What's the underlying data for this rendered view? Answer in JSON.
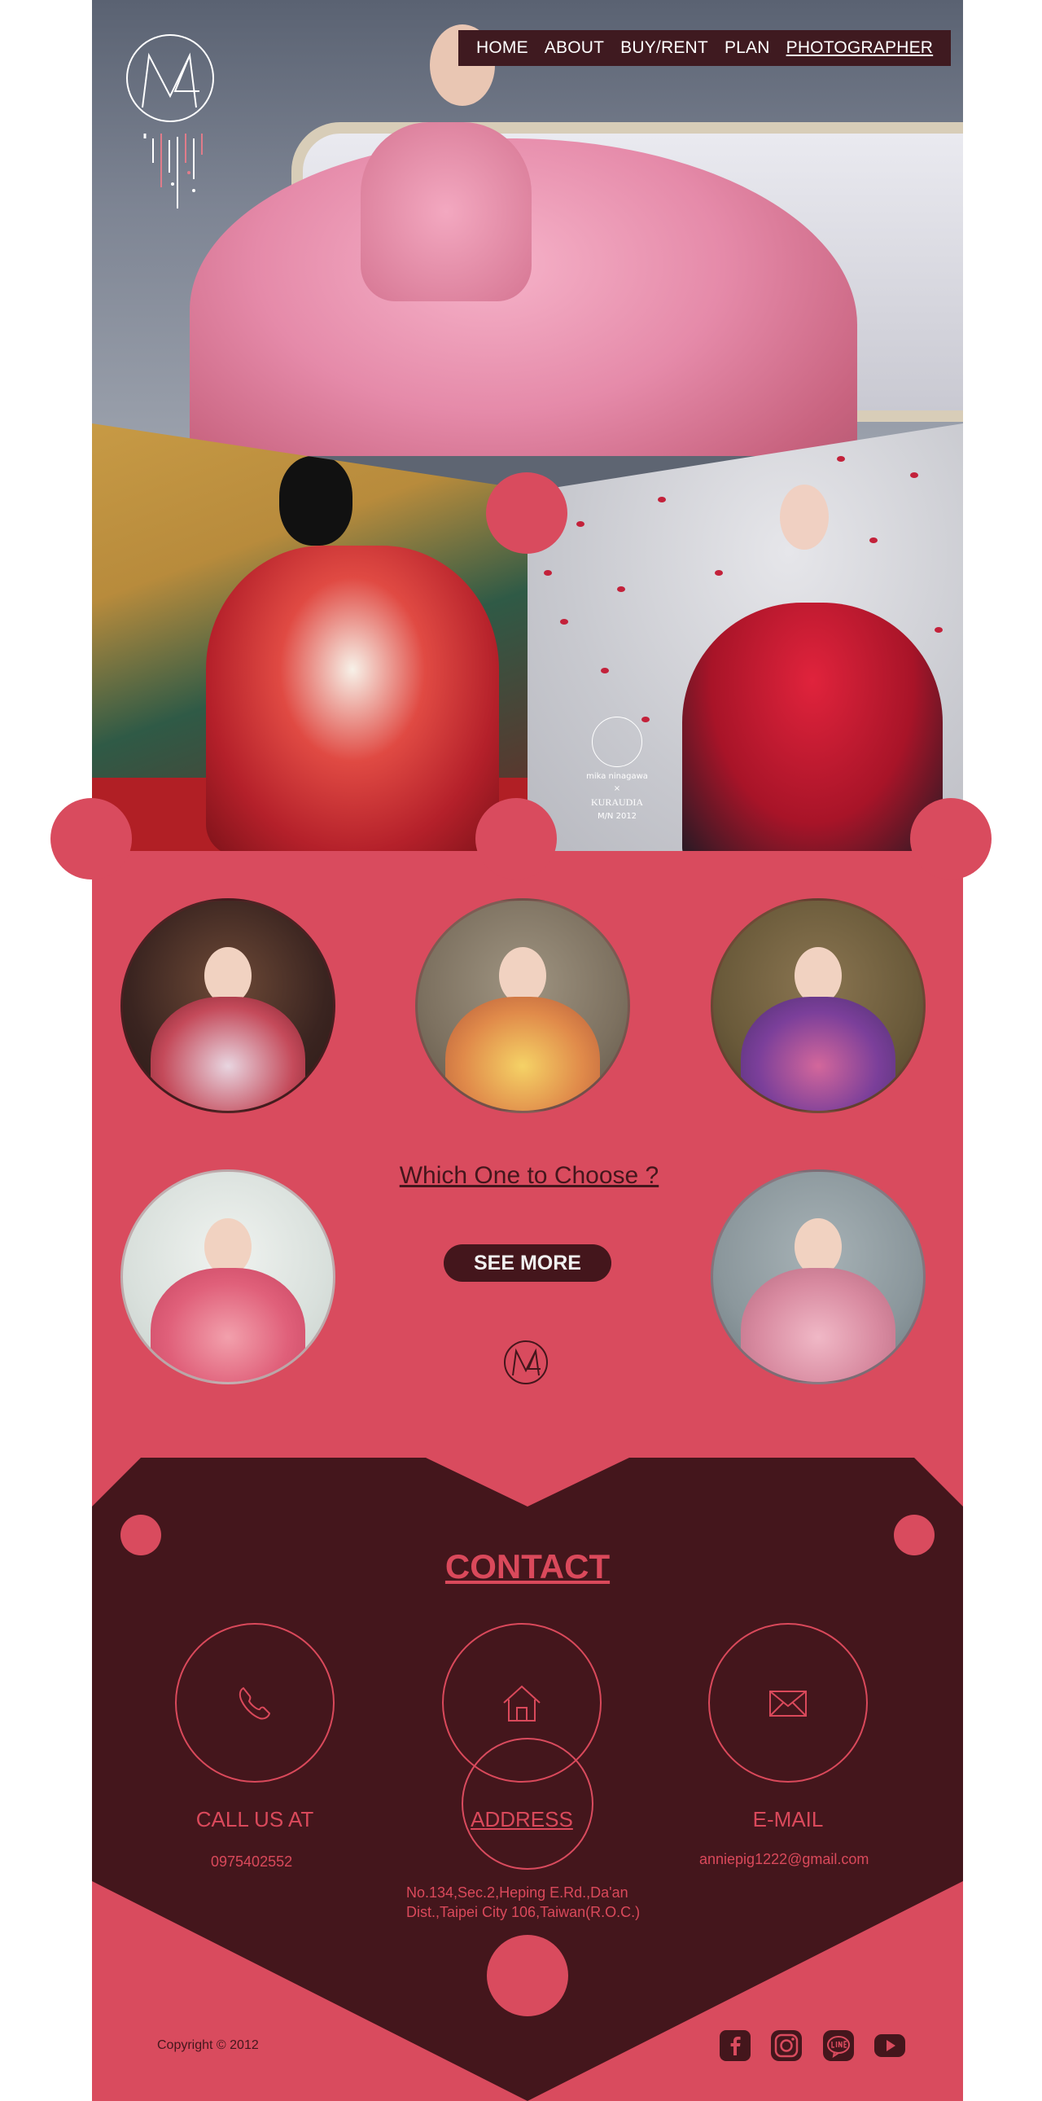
{
  "nav": {
    "items": [
      {
        "label": "HOME"
      },
      {
        "label": "ABOUT"
      },
      {
        "label": "BUY/RENT"
      },
      {
        "label": "PLAN"
      },
      {
        "label": "PHOTOGRAPHER"
      }
    ]
  },
  "hero": {
    "brand": {
      "name": "mika ninagawa",
      "times": "×",
      "partner": "KURAUDIA",
      "line": "M/N 2012"
    }
  },
  "gallery": {
    "title": "Which One to Choose ?",
    "cta_label": "SEE MORE"
  },
  "contact": {
    "title": "CONTACT",
    "phone": {
      "label": "CALL US AT",
      "value": "0975402552"
    },
    "address": {
      "label": "ADDRESS",
      "line1": "No.134,Sec.2,Heping E.Rd.,Da'an",
      "line2": "Dist.,Taipei City 106,Taiwan(R.O.C.)"
    },
    "email": {
      "label": "E-MAIL",
      "value": "anniepig1222@gmail.com"
    }
  },
  "footer": {
    "copyright": "Copyright © 2012"
  },
  "colors": {
    "accent": "#DA495B",
    "dark": "#44161C",
    "light": "#F1F1F1",
    "white": "#FFFFFF"
  }
}
